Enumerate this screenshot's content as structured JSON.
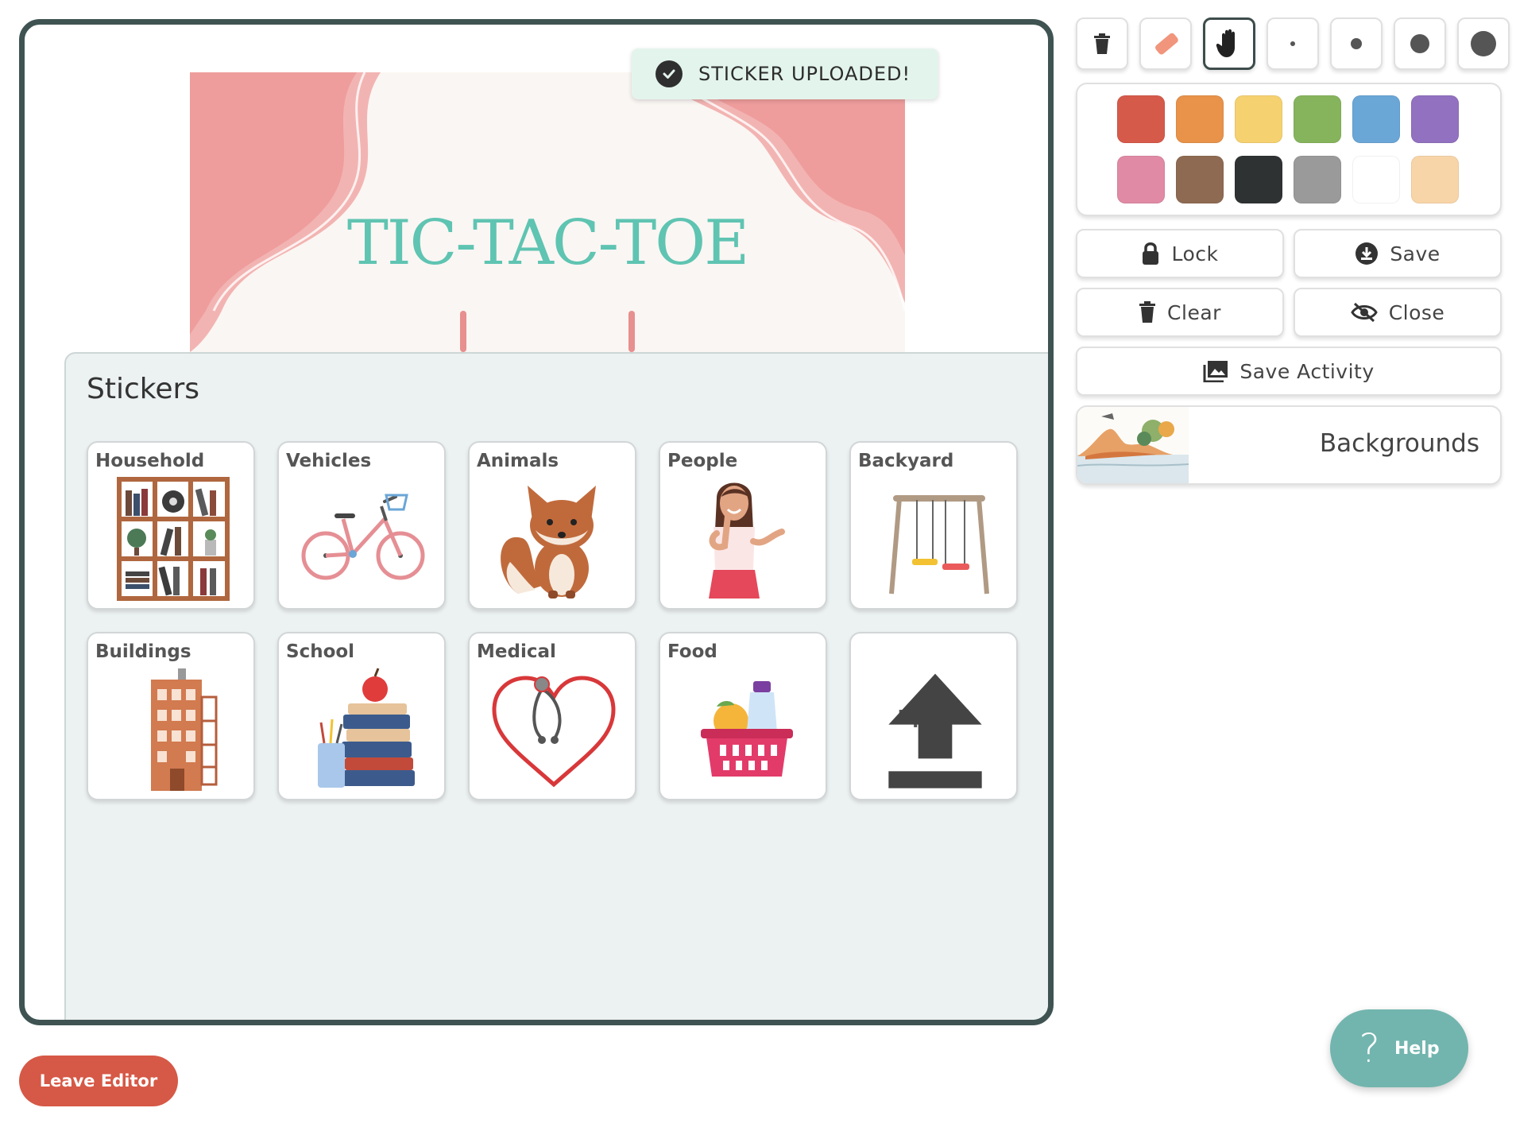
{
  "toast": {
    "message": "STICKER UPLOADED!"
  },
  "canvas": {
    "title": "TIC-TAC-TOE"
  },
  "stickers": {
    "title": "Stickers",
    "categories": [
      {
        "label": "Household"
      },
      {
        "label": "Vehicles"
      },
      {
        "label": "Animals"
      },
      {
        "label": "People"
      },
      {
        "label": "Backyard"
      },
      {
        "label": "Buildings"
      },
      {
        "label": "School"
      },
      {
        "label": "Medical"
      },
      {
        "label": "Food"
      }
    ],
    "upload_label": "Upload"
  },
  "toolbar": {
    "tools": [
      "trash-icon",
      "eraser-icon",
      "hand-icon",
      "brush-size-xs",
      "brush-size-s",
      "brush-size-m",
      "brush-size-l"
    ],
    "active_tool": "hand-icon"
  },
  "palette": {
    "colors": [
      "#d65a4a",
      "#e8924a",
      "#f5d170",
      "#86b45d",
      "#6aa6d6",
      "#9271c0",
      "#e08aa5",
      "#8e6a52",
      "#2f3233",
      "#9a9a9a",
      "#ffffff",
      "#f8d5a8"
    ]
  },
  "actions": {
    "lock": "Lock",
    "save": "Save",
    "clear": "Clear",
    "close": "Close",
    "save_activity": "Save Activity"
  },
  "backgrounds": {
    "label": "Backgrounds"
  },
  "footer": {
    "leave_label": "Leave Editor",
    "help_label": "Help",
    "help_glyph": "?"
  }
}
